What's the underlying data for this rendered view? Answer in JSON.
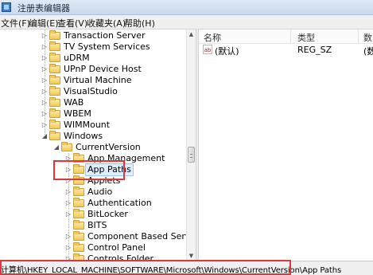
{
  "window": {
    "title": "注册表编辑器"
  },
  "menu": [
    "文件(F)",
    "编辑(E)",
    "查看(V)",
    "收藏夹(A)",
    "帮助(H)"
  ],
  "tree": {
    "items": [
      {
        "label": "Transaction Server",
        "level": 1,
        "expander": "▷"
      },
      {
        "label": "TV System Services",
        "level": 1,
        "expander": "▷"
      },
      {
        "label": "uDRM",
        "level": 1,
        "expander": "▷"
      },
      {
        "label": "UPnP Device Host",
        "level": 1,
        "expander": "▷"
      },
      {
        "label": "Virtual Machine",
        "level": 1,
        "expander": "▷"
      },
      {
        "label": "VisualStudio",
        "level": 1,
        "expander": "▷"
      },
      {
        "label": "WAB",
        "level": 1,
        "expander": "▷"
      },
      {
        "label": "WBEM",
        "level": 1,
        "expander": "▷"
      },
      {
        "label": "WIMMount",
        "level": 1,
        "expander": "▷"
      },
      {
        "label": "Windows",
        "level": 1,
        "expander": "◢"
      },
      {
        "label": "CurrentVersion",
        "level": 2,
        "expander": "◢"
      },
      {
        "label": "App Management",
        "level": 3,
        "expander": "▷"
      },
      {
        "label": "App Paths",
        "level": 3,
        "expander": "▷",
        "selected": true
      },
      {
        "label": "Applets",
        "level": 3,
        "expander": "▷"
      },
      {
        "label": "Audio",
        "level": 3,
        "expander": "▷"
      },
      {
        "label": "Authentication",
        "level": 3,
        "expander": "▷"
      },
      {
        "label": "BitLocker",
        "level": 3,
        "expander": "▷"
      },
      {
        "label": "BITS",
        "level": 3,
        "expander": ""
      },
      {
        "label": "Component Based Servicing",
        "level": 3,
        "expander": "▷"
      },
      {
        "label": "Control Panel",
        "level": 3,
        "expander": "▷"
      },
      {
        "label": "Controls Folder",
        "level": 3,
        "expander": "▷"
      }
    ]
  },
  "list": {
    "columns": [
      "名称",
      "类型",
      "数"
    ],
    "rows": [
      {
        "icon": "ab",
        "name": "(默认)",
        "type": "REG_SZ",
        "data": "(数"
      }
    ]
  },
  "status": {
    "path": "计算机\\HKEY_LOCAL_MACHINE\\SOFTWARE\\Microsoft\\Windows\\CurrentVersion\\App Paths"
  },
  "colors": {
    "highlight_box": "#d9393c",
    "selection": "#ddeeff",
    "folder": "#f1c95a"
  }
}
